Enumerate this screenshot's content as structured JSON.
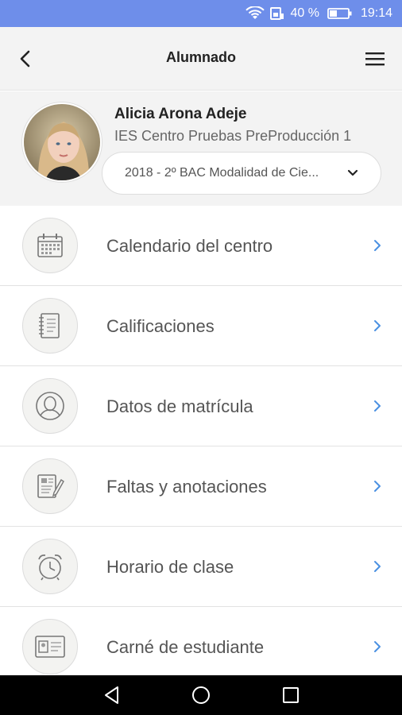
{
  "status_bar": {
    "battery_pct": "40 %",
    "time": "19:14"
  },
  "header": {
    "title": "Alumnado"
  },
  "profile": {
    "name": "Alicia Arona Adeje",
    "school": "IES Centro Pruebas PreProducción 1",
    "course_selected": "2018 - 2º BAC Modalidad de Cie..."
  },
  "menu": {
    "items": [
      {
        "label": "Calendario del centro",
        "icon": "calendar-icon"
      },
      {
        "label": "Calificaciones",
        "icon": "notebook-icon"
      },
      {
        "label": "Datos de matrícula",
        "icon": "user-icon"
      },
      {
        "label": "Faltas y anotaciones",
        "icon": "note-edit-icon"
      },
      {
        "label": "Horario de clase",
        "icon": "alarm-clock-icon"
      },
      {
        "label": "Carné de estudiante",
        "icon": "id-card-icon"
      }
    ]
  },
  "colors": {
    "status_bar": "#6e8eea",
    "accent_arrow": "#4a90e2",
    "header_bg": "#f3f3f3"
  }
}
